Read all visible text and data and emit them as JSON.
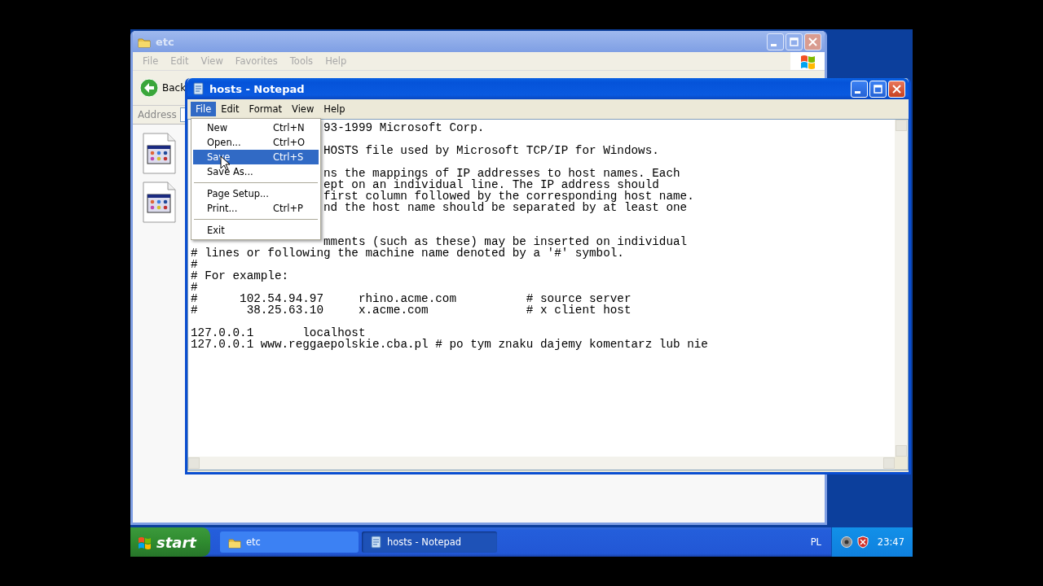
{
  "explorer": {
    "title": "etc",
    "active": false,
    "menu": [
      "File",
      "Edit",
      "View",
      "Favorites",
      "Tools",
      "Help"
    ],
    "back_label": "Back",
    "address_label": "Address",
    "files": [
      {
        "kind": "document"
      },
      {
        "kind": "document"
      }
    ]
  },
  "notepad": {
    "title": "hosts - Notepad",
    "active": true,
    "menu": [
      {
        "label": "File",
        "selected": true
      },
      {
        "label": "Edit",
        "selected": false
      },
      {
        "label": "Format",
        "selected": false
      },
      {
        "label": "View",
        "selected": false
      },
      {
        "label": "Help",
        "selected": false
      }
    ],
    "file_menu": [
      {
        "kind": "item",
        "label": "New",
        "shortcut": "Ctrl+N",
        "selected": false
      },
      {
        "kind": "item",
        "label": "Open...",
        "shortcut": "Ctrl+O",
        "selected": false
      },
      {
        "kind": "item",
        "label": "Save",
        "shortcut": "Ctrl+S",
        "selected": true
      },
      {
        "kind": "item",
        "label": "Save As...",
        "selected": false
      },
      {
        "kind": "separator"
      },
      {
        "kind": "item",
        "label": "Page Setup...",
        "selected": false
      },
      {
        "kind": "item",
        "label": "Print...",
        "shortcut": "Ctrl+P",
        "selected": false
      },
      {
        "kind": "separator"
      },
      {
        "kind": "item",
        "label": "Exit",
        "selected": false
      }
    ],
    "lines": [
      {
        "kind": "behind_menu",
        "text": "93-1999 Microsoft Corp."
      },
      {
        "kind": "hidden"
      },
      {
        "kind": "behind_menu",
        "text": "HOSTS file used by Microsoft TCP/IP for Windows."
      },
      {
        "kind": "hidden"
      },
      {
        "kind": "behind_menu",
        "text": "ns the mappings of IP addresses to host names. Each"
      },
      {
        "kind": "behind_menu",
        "text": "ept on an individual line. The IP address should"
      },
      {
        "kind": "behind_menu",
        "text": "first column followed by the corresponding host name."
      },
      {
        "kind": "behind_menu",
        "text": "nd the host name should be separated by at least one"
      },
      {
        "kind": "hidden"
      },
      {
        "kind": "hidden"
      },
      {
        "kind": "behind_menu",
        "text": "mments (such as these) may be inserted on individual"
      },
      {
        "kind": "full",
        "text": "# lines or following the machine name denoted by a '#' symbol."
      },
      {
        "kind": "full",
        "text": "#"
      },
      {
        "kind": "full",
        "text": "# For example:"
      },
      {
        "kind": "full",
        "text": "#"
      },
      {
        "kind": "full",
        "text": "#      102.54.94.97     rhino.acme.com          # source server"
      },
      {
        "kind": "full",
        "text": "#       38.25.63.10     x.acme.com              # x client host"
      },
      {
        "kind": "hidden"
      },
      {
        "kind": "full",
        "text": "127.0.0.1       localhost"
      },
      {
        "kind": "full",
        "text": "127.0.0.1 www.reggaepolskie.cba.pl # po tym znaku dajemy komentarz lub nie"
      }
    ]
  },
  "taskbar": {
    "start_label": "start",
    "buttons": [
      {
        "label": "etc",
        "kind": "folder",
        "selected": false
      },
      {
        "label": "hosts - Notepad",
        "kind": "notepad",
        "selected": true
      }
    ],
    "language": "PL",
    "clock": "23:47"
  }
}
